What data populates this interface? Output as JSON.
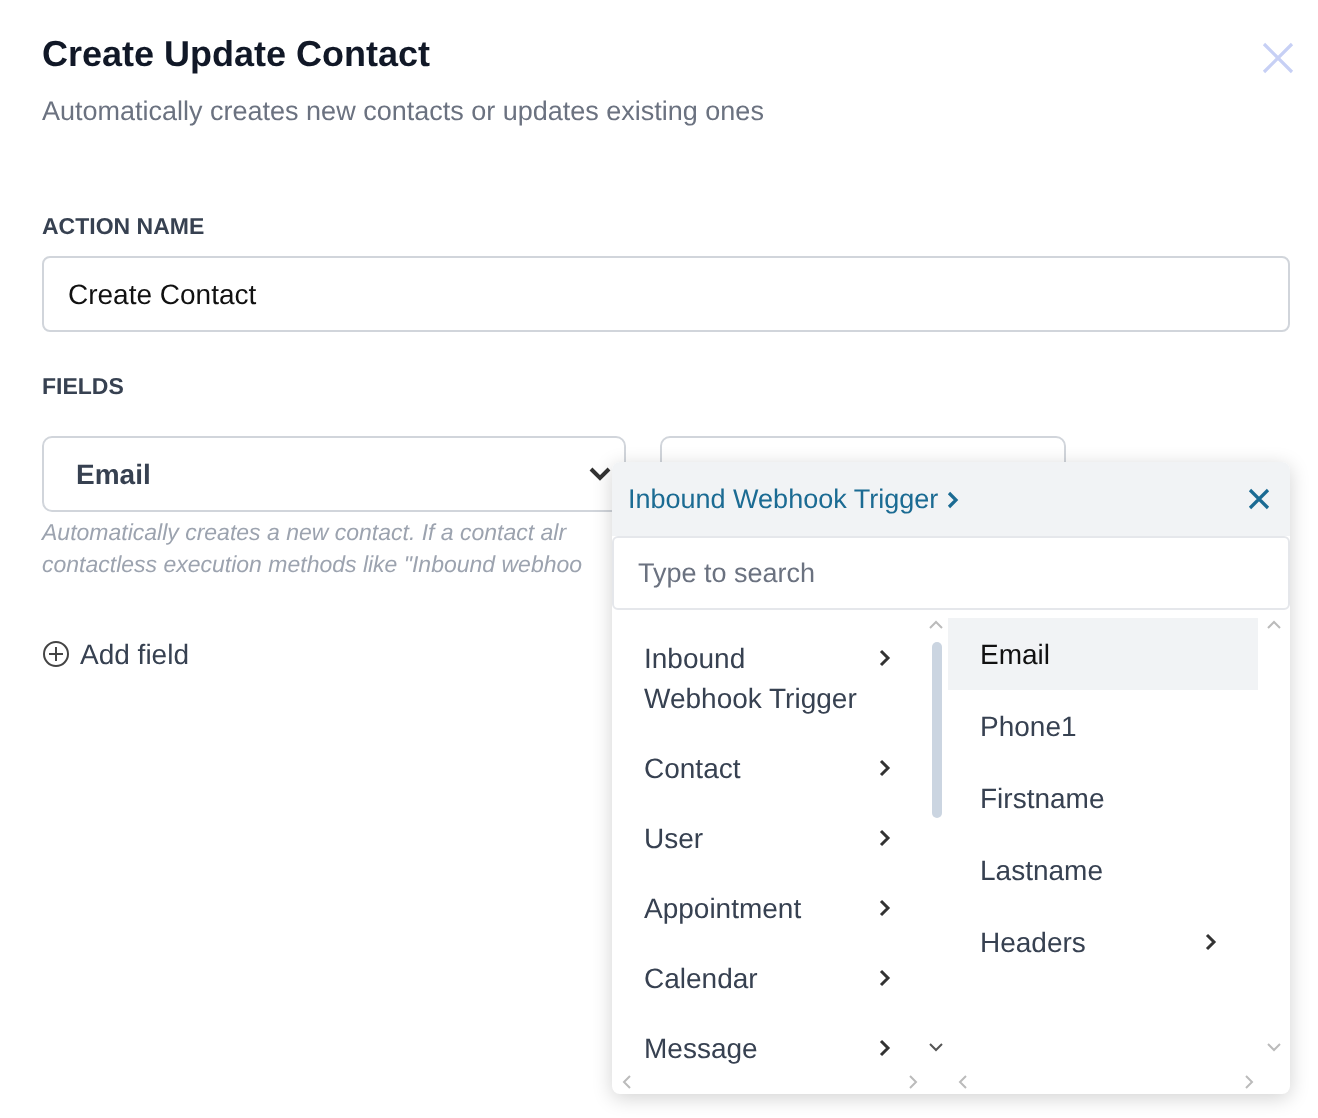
{
  "dialog": {
    "title": "Create Update Contact",
    "subtitle": "Automatically creates new contacts or updates existing ones"
  },
  "action_name": {
    "label": "ACTION NAME",
    "value": "Create Contact"
  },
  "fields": {
    "label": "FIELDS",
    "field_select": {
      "value": "Email"
    },
    "help_lines": [
      "Automatically creates a new contact. If a contact alr",
      "contactless execution methods like \"Inbound webhoo"
    ],
    "add_field": "Add field"
  },
  "picker": {
    "breadcrumb": "Inbound Webhook Trigger",
    "search": {
      "placeholder": "Type to search"
    },
    "categories": [
      {
        "label": "Inbound Webhook Trigger",
        "has_submenu": true
      },
      {
        "label": "Contact",
        "has_submenu": true
      },
      {
        "label": "User",
        "has_submenu": true
      },
      {
        "label": "Appointment",
        "has_submenu": true
      },
      {
        "label": "Calendar",
        "has_submenu": true
      },
      {
        "label": "Message",
        "has_submenu": true
      }
    ],
    "options": [
      {
        "label": "Email",
        "selected": true,
        "has_submenu": false
      },
      {
        "label": "Phone1",
        "selected": false,
        "has_submenu": false
      },
      {
        "label": "Firstname",
        "selected": false,
        "has_submenu": false
      },
      {
        "label": "Lastname",
        "selected": false,
        "has_submenu": false
      },
      {
        "label": "Headers",
        "selected": false,
        "has_submenu": true
      }
    ]
  }
}
